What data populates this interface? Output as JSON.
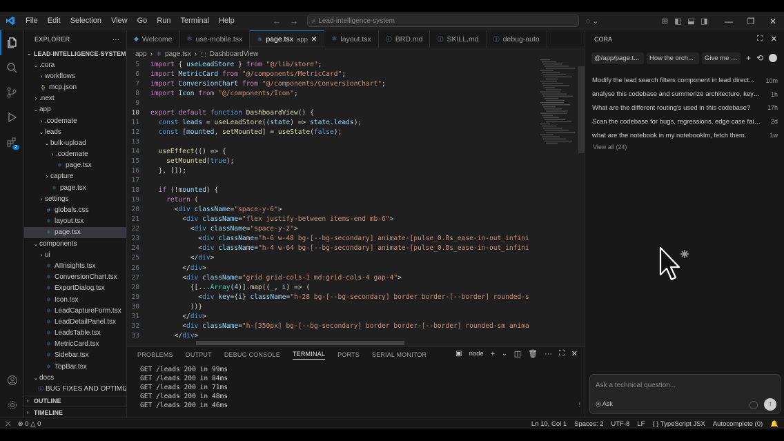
{
  "window": {
    "menu": [
      "File",
      "Edit",
      "Selection",
      "View",
      "Go",
      "Run",
      "Terminal",
      "Help"
    ],
    "search_text": "Lead-intelligence-system"
  },
  "explorer": {
    "title": "EXPLORER",
    "root": "LEAD-INTELLIGENCE-SYSTEM",
    "items": [
      {
        "label": ".cora",
        "depth": 1,
        "type": "folder",
        "open": true
      },
      {
        "label": "workflows",
        "depth": 2,
        "type": "folder",
        "open": false
      },
      {
        "label": "mcp.json",
        "depth": 1,
        "type": "json"
      },
      {
        "label": ".next",
        "depth": 1,
        "type": "folder",
        "open": false
      },
      {
        "label": "app",
        "depth": 1,
        "type": "folder",
        "open": true
      },
      {
        "label": ".codemate",
        "depth": 2,
        "type": "folder",
        "open": false
      },
      {
        "label": "leads",
        "depth": 2,
        "type": "folder",
        "open": true
      },
      {
        "label": "bulk-upload",
        "depth": 3,
        "type": "folder",
        "open": true
      },
      {
        "label": ".codemate",
        "depth": 4,
        "type": "folder",
        "open": false
      },
      {
        "label": "page.tsx",
        "depth": 4,
        "type": "tsx"
      },
      {
        "label": "capture",
        "depth": 3,
        "type": "folder",
        "open": false
      },
      {
        "label": "page.tsx",
        "depth": 3,
        "type": "tsx"
      },
      {
        "label": "settings",
        "depth": 2,
        "type": "folder",
        "open": false
      },
      {
        "label": "globals.css",
        "depth": 2,
        "type": "css"
      },
      {
        "label": "layout.tsx",
        "depth": 2,
        "type": "tsx"
      },
      {
        "label": "page.tsx",
        "depth": 2,
        "type": "tsx",
        "selected": true
      },
      {
        "label": "components",
        "depth": 1,
        "type": "folder",
        "open": true
      },
      {
        "label": "ui",
        "depth": 2,
        "type": "folder",
        "open": false
      },
      {
        "label": "AIInsights.tsx",
        "depth": 2,
        "type": "tsx"
      },
      {
        "label": "ConversionChart.tsx",
        "depth": 2,
        "type": "tsx"
      },
      {
        "label": "ExportDialog.tsx",
        "depth": 2,
        "type": "tsx"
      },
      {
        "label": "Icon.tsx",
        "depth": 2,
        "type": "tsx"
      },
      {
        "label": "LeadCaptureForm.tsx",
        "depth": 2,
        "type": "tsx"
      },
      {
        "label": "LeadDetailPanel.tsx",
        "depth": 2,
        "type": "tsx"
      },
      {
        "label": "LeadsTable.tsx",
        "depth": 2,
        "type": "tsx"
      },
      {
        "label": "MetricCard.tsx",
        "depth": 2,
        "type": "tsx"
      },
      {
        "label": "Sidebar.tsx",
        "depth": 2,
        "type": "tsx"
      },
      {
        "label": "TopBar.tsx",
        "depth": 2,
        "type": "tsx"
      },
      {
        "label": "docs",
        "depth": 1,
        "type": "folder",
        "open": true
      },
      {
        "label": "BUG FIXES AND OPTIMIZ...",
        "depth": 2,
        "type": "md"
      }
    ],
    "outline": "OUTLINE",
    "timeline": "TIMELINE"
  },
  "tabs": [
    {
      "label": "Welcome",
      "icon": "vscode"
    },
    {
      "label": "use-mobile.tsx",
      "icon": "tsx"
    },
    {
      "label": "page.tsx",
      "sub": "app",
      "icon": "tsx",
      "active": true
    },
    {
      "label": "layout.tsx",
      "icon": "tsx"
    },
    {
      "label": "BRD.md",
      "icon": "md"
    },
    {
      "label": "SKILL.md",
      "icon": "md"
    },
    {
      "label": "debug-auto",
      "icon": "md"
    }
  ],
  "breadcrumb": [
    "app",
    "page.tsx",
    "DashboardView"
  ],
  "code_lines": [
    {
      "n": "5",
      "html": "<span class='kw2'>import</span> <span class='pn'>{</span> <span class='var'>useLeadStore</span> <span class='pn'>}</span> <span class='kw2'>from</span> <span class='str'>\"@/lib/store\"</span><span class='pn'>;</span>"
    },
    {
      "n": "6",
      "html": "<span class='kw2'>import</span> <span class='var'>MetricCard</span> <span class='kw2'>from</span> <span class='str'>\"@/components/MetricCard\"</span><span class='pn'>;</span>"
    },
    {
      "n": "7",
      "html": "<span class='kw2'>import</span> <span class='var'>ConversionChart</span> <span class='kw2'>from</span> <span class='str'>\"@/components/ConversionChart\"</span><span class='pn'>;</span>"
    },
    {
      "n": "8",
      "html": "<span class='kw2'>import</span> <span class='var'>Icon</span> <span class='kw2'>from</span> <span class='str'>\"@/components/Icon\"</span><span class='pn'>;</span>"
    },
    {
      "n": "9",
      "html": ""
    },
    {
      "n": "10",
      "html": "<span class='kw2'>export</span> <span class='kw2'>default</span> <span class='kw'>function</span> <span class='fn'>DashboardView</span><span class='pn'>() {</span>",
      "cur": true
    },
    {
      "n": "11",
      "html": "  <span class='kw'>const</span> <span class='var'>leads</span> <span class='pn'>=</span> <span class='fn'>useLeadStore</span><span class='pn'>((</span><span class='var'>state</span><span class='pn'>) =&gt;</span> <span class='var'>state</span><span class='pn'>.</span><span class='var'>leads</span><span class='pn'>);</span>"
    },
    {
      "n": "12",
      "html": "  <span class='kw'>const</span> <span class='pn'>[</span><span class='var'>mounted</span><span class='pn'>,</span> <span class='fn'>setMounted</span><span class='pn'>]</span> <span class='pn'>=</span> <span class='fn'>useState</span><span class='pn'>(</span><span class='kw'>false</span><span class='pn'>);</span>"
    },
    {
      "n": "13",
      "html": ""
    },
    {
      "n": "14",
      "html": "  <span class='fn'>useEffect</span><span class='pn'>(() =&gt; {</span>"
    },
    {
      "n": "15",
      "html": "    <span class='fn'>setMounted</span><span class='pn'>(</span><span class='kw'>true</span><span class='pn'>);</span>"
    },
    {
      "n": "16",
      "html": "  <span class='pn'>}, []);</span>"
    },
    {
      "n": "17",
      "html": ""
    },
    {
      "n": "18",
      "html": "  <span class='kw2'>if</span> <span class='pn'>(!</span><span class='var'>mounted</span><span class='pn'>) {</span>"
    },
    {
      "n": "19",
      "html": "    <span class='kw2'>return</span> <span class='pn'>(</span>"
    },
    {
      "n": "20",
      "html": "      <span class='pn'>&lt;</span><span class='tag'>div</span> <span class='attr'>className</span><span class='pn'>=</span><span class='str'>\"space-y-6\"</span><span class='pn'>&gt;</span>"
    },
    {
      "n": "21",
      "html": "        <span class='pn'>&lt;</span><span class='tag'>div</span> <span class='attr'>className</span><span class='pn'>=</span><span class='str'>\"flex justify-between items-end mb-6\"</span><span class='pn'>&gt;</span>"
    },
    {
      "n": "22",
      "html": "          <span class='pn'>&lt;</span><span class='tag'>div</span> <span class='attr'>className</span><span class='pn'>=</span><span class='str'>\"space-y-2\"</span><span class='pn'>&gt;</span>"
    },
    {
      "n": "23",
      "html": "            <span class='pn'>&lt;</span><span class='tag'>div</span> <span class='attr'>className</span><span class='pn'>=</span><span class='str'>\"h-6 w-48 bg-[--bg-secondary] animate-[pulse_0.8s_ease-in-out_infini</span>"
    },
    {
      "n": "24",
      "html": "            <span class='pn'>&lt;</span><span class='tag'>div</span> <span class='attr'>className</span><span class='pn'>=</span><span class='str'>\"h-4 w-64 bg-[--bg-secondary] animate-[pulse_0.8s_ease-in-out_infini</span>"
    },
    {
      "n": "25",
      "html": "          <span class='pn'>&lt;/</span><span class='tag'>div</span><span class='pn'>&gt;</span>"
    },
    {
      "n": "26",
      "html": "        <span class='pn'>&lt;/</span><span class='tag'>div</span><span class='pn'>&gt;</span>"
    },
    {
      "n": "27",
      "html": "        <span class='pn'>&lt;</span><span class='tag'>div</span> <span class='attr'>className</span><span class='pn'>=</span><span class='str'>\"grid grid-cols-1 md:grid-cols-4 gap-4\"</span><span class='pn'>&gt;</span>"
    },
    {
      "n": "28",
      "html": "          <span class='pn'>{[...</span><span class='cls'>Array</span><span class='pn'>(</span><span class='var'>4</span><span class='pn'>)].</span><span class='fn'>map</span><span class='pn'>((</span><span class='var'>_</span><span class='pn'>,</span> <span class='var'>i</span><span class='pn'>) =&gt; (</span>"
    },
    {
      "n": "29",
      "html": "            <span class='pn'>&lt;</span><span class='tag'>div</span> <span class='attr'>key</span><span class='pn'>={</span><span class='var'>i</span><span class='pn'>}</span> <span class='attr'>className</span><span class='pn'>=</span><span class='str'>\"h-28 bg-[--bg-secondary] border border-[--border] rounded-s</span>"
    },
    {
      "n": "30",
      "html": "          <span class='pn'>))}</span>"
    },
    {
      "n": "31",
      "html": "        <span class='pn'>&lt;/</span><span class='tag'>div</span><span class='pn'>&gt;</span>"
    },
    {
      "n": "32",
      "html": "        <span class='pn'>&lt;</span><span class='tag'>div</span> <span class='attr'>className</span><span class='pn'>=</span><span class='str'>\"h-[350px] bg-[--bg-secondary] border border-[--border] rounded-sm anima</span>"
    },
    {
      "n": "33",
      "html": "      <span class='pn'>&lt;/</span><span class='tag'>div</span><span class='pn'>&gt;</span>"
    }
  ],
  "panel": {
    "tabs": [
      "PROBLEMS",
      "OUTPUT",
      "DEBUG CONSOLE",
      "TERMINAL",
      "PORTS",
      "SERIAL MONITOR"
    ],
    "active_tab": "TERMINAL",
    "shell": "node",
    "terminal_lines": [
      "GET /leads 200 in 99ms",
      "GET /leads 200 in 84ms",
      "GET /leads 200 in 71ms",
      "GET /leads 200 in 48ms",
      "GET /leads 200 in 46ms"
    ]
  },
  "cora": {
    "title": "CORA",
    "chips": [
      "@/app/page.t...",
      "How the orch...",
      "Give me a d"
    ],
    "history": [
      {
        "text": "Modify the lead search filters component in lead direct...",
        "time": "10m"
      },
      {
        "text": "analyse this codebase and summerize architecture, key m...",
        "time": "1h"
      },
      {
        "text": "What are the different routing's used in this codebase?",
        "time": "17h"
      },
      {
        "text": "Scan the codebase for bugs, regressions, edge case failur...",
        "time": "2d"
      },
      {
        "text": "what are the notebook in my notebooklm, fetch them.",
        "time": "1w"
      }
    ],
    "view_all": "View all (24)",
    "ask_placeholder": "Ask a technical question...",
    "ask_mode": "Ask"
  },
  "status": {
    "errors": "0",
    "warnings": "0",
    "position": "Ln 10, Col 1",
    "spaces": "Spaces: 2",
    "encoding": "UTF-8",
    "eol": "LF",
    "language": "TypeScript JSX",
    "autocomplete": "Autocomplete (0)"
  },
  "colors": {
    "accent": "#0078d4",
    "bg": "#1f1f1f",
    "sidebar": "#181818"
  }
}
